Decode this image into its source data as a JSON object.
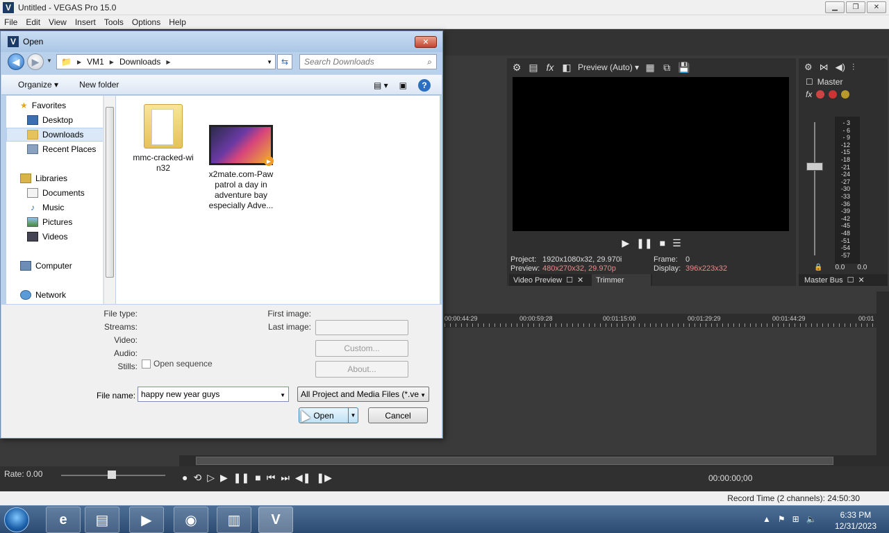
{
  "app": {
    "title": "Untitled - VEGAS Pro 15.0",
    "logo": "V",
    "menu": [
      "File",
      "Edit",
      "View",
      "Insert",
      "Tools",
      "Options",
      "Help"
    ]
  },
  "preview": {
    "mode": "Preview (Auto)",
    "project_label": "Project:",
    "project_value": "1920x1080x32, 29.970i",
    "preview_label": "Preview:",
    "preview_value": "480x270x32, 29.970p",
    "frame_label": "Frame:",
    "frame_value": "0",
    "display_label": "Display:",
    "display_value": "396x223x32",
    "tab_video_preview": "Video Preview",
    "tab_trimmer": "Trimmer"
  },
  "master": {
    "name": "Master",
    "fx": "fx",
    "scale": [
      "- 3",
      "- 6",
      "- 9",
      "-12",
      "-15",
      "-18",
      "-21",
      "-24",
      "-27",
      "-30",
      "-33",
      "-36",
      "-39",
      "-42",
      "-45",
      "-48",
      "-51",
      "-54",
      "-57"
    ],
    "left_value": "0.0",
    "right_value": "0.0",
    "tab": "Master Bus"
  },
  "timeline": {
    "ruler": [
      "00:00:44:29",
      "00:00:59:28",
      "00:01:15:00",
      "00:01:29:29",
      "00:01:44:29",
      "00:01"
    ],
    "rate": "Rate: 0.00",
    "timecode": "00:00:00;00",
    "record_time": "Record Time (2 channels): 24:50:30"
  },
  "dialog": {
    "title": "Open",
    "logo": "V",
    "close": "✕",
    "breadcrumb": [
      "VM1",
      "Downloads"
    ],
    "search_placeholder": "Search Downloads",
    "organize": "Organize ▾",
    "new_folder": "New folder",
    "nav": {
      "favorites": "Favorites",
      "desktop": "Desktop",
      "downloads": "Downloads",
      "recent": "Recent Places",
      "libraries": "Libraries",
      "documents": "Documents",
      "music": "Music",
      "pictures": "Pictures",
      "videos": "Videos",
      "computer": "Computer",
      "network": "Network"
    },
    "files": [
      {
        "name_line1": "mmc-cracked-wi",
        "name_line2": "n32"
      },
      {
        "name_line1": "x2mate.com-Paw",
        "name_line2": "patrol a day in",
        "name_line3": "adventure bay",
        "name_line4": "especially Adve..."
      }
    ],
    "details": {
      "file_type": "File type:",
      "streams": "Streams:",
      "video": "Video:",
      "audio": "Audio:",
      "stills": "Stills:",
      "open_sequence": "Open sequence",
      "first_image": "First image:",
      "last_image": "Last image:",
      "custom": "Custom...",
      "about": "About..."
    },
    "file_name_label": "File name:",
    "file_name_value": "happy new year guys",
    "filter": "All Project and Media Files (*.ve",
    "open_button": "Open",
    "cancel_button": "Cancel"
  },
  "taskbar": {
    "time": "6:33 PM",
    "date": "12/31/2023"
  },
  "colors": {
    "accent": "#2a6fc0",
    "dialog_frame": "#b9d1ea",
    "preview_highlight": "#e88888"
  }
}
